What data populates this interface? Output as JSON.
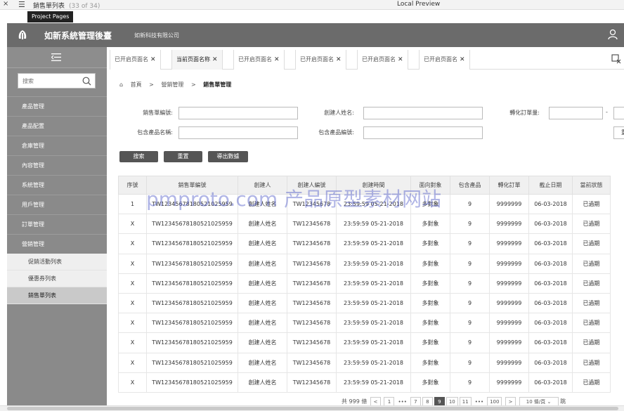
{
  "window": {
    "close_glyph": "×",
    "menu_glyph": "☰",
    "page_title": "銷售單列表",
    "page_count": "(33 of 34)",
    "center_title": "Local Preview",
    "tooltip": "Project Pages"
  },
  "header": {
    "system_title": "如新系統管理後臺",
    "company": "如新科技有限公司"
  },
  "sidebar": {
    "search_placeholder": "搜索",
    "items": [
      {
        "label": "產品管理"
      },
      {
        "label": "產品配置"
      },
      {
        "label": "倉庫管理"
      },
      {
        "label": "內容管理"
      },
      {
        "label": "系統管理"
      },
      {
        "label": "用戶管理"
      },
      {
        "label": "訂單管理"
      },
      {
        "label": "營銷管理"
      }
    ],
    "sub_items": [
      {
        "label": "促銷活動列表"
      },
      {
        "label": "優惠券列表"
      },
      {
        "label": "銷售單列表"
      }
    ]
  },
  "tabs": [
    {
      "label": "已开启页面名"
    },
    {
      "label": "当前页面名称"
    },
    {
      "label": "已开启页面名"
    },
    {
      "label": "已开启页面名"
    },
    {
      "label": "已开启页面名"
    },
    {
      "label": "已开启页面名"
    }
  ],
  "tab_close_glyph": "✕",
  "breadcrumb": {
    "home": "首頁",
    "sep": ">",
    "level1": "營銷管理",
    "current": "銷售單管理"
  },
  "form": {
    "order_no_label": "銷售單編號:",
    "creator_name_label": "創建人姓名:",
    "convert_qty_label": "轉化訂單量:",
    "range_sep": "-",
    "product_name_label": "包含產品名稱:",
    "product_no_label": "包含產品編號:",
    "reset_partial": "重"
  },
  "buttons": {
    "search": "搜索",
    "reset": "重置",
    "export": "導出數據"
  },
  "table": {
    "headers": [
      "序號",
      "銷售單編號",
      "創建人",
      "創建人編號",
      "創建時間",
      "面向對象",
      "包含產品",
      "轉化訂單",
      "截止日期",
      "當前狀態"
    ],
    "rows": [
      [
        "1",
        "TW12345678180521025959",
        "創建人姓名",
        "TW12345678",
        "23:59:59 05-21-2018",
        "多對象",
        "9",
        "9999999",
        "06-03-2018",
        "已過期"
      ],
      [
        "X",
        "TW12345678180521025959",
        "創建人姓名",
        "TW12345678",
        "23:59:59 05-21-2018",
        "多對象",
        "9",
        "9999999",
        "06-03-2018",
        "已過期"
      ],
      [
        "X",
        "TW12345678180521025959",
        "創建人姓名",
        "TW12345678",
        "23:59:59 05-21-2018",
        "多對象",
        "9",
        "9999999",
        "06-03-2018",
        "已過期"
      ],
      [
        "X",
        "TW12345678180521025959",
        "創建人姓名",
        "TW12345678",
        "23:59:59 05-21-2018",
        "多對象",
        "9",
        "9999999",
        "06-03-2018",
        "已過期"
      ],
      [
        "X",
        "TW12345678180521025959",
        "創建人姓名",
        "TW12345678",
        "23:59:59 05-21-2018",
        "多對象",
        "9",
        "9999999",
        "06-03-2018",
        "已過期"
      ],
      [
        "X",
        "TW12345678180521025959",
        "創建人姓名",
        "TW12345678",
        "23:59:59 05-21-2018",
        "多對象",
        "9",
        "9999999",
        "06-03-2018",
        "已過期"
      ],
      [
        "X",
        "TW12345678180521025959",
        "創建人姓名",
        "TW12345678",
        "23:59:59 05-21-2018",
        "多對象",
        "9",
        "9999999",
        "06-03-2018",
        "已過期"
      ],
      [
        "X",
        "TW12345678180521025959",
        "創建人姓名",
        "TW12345678",
        "23:59:59 05-21-2018",
        "多對象",
        "9",
        "9999999",
        "06-03-2018",
        "已過期"
      ],
      [
        "X",
        "TW12345678180521025959",
        "創建人姓名",
        "TW12345678",
        "23:59:59 05-21-2018",
        "多對象",
        "9",
        "9999999",
        "06-03-2018",
        "已過期"
      ],
      [
        "X",
        "TW12345678180521025959",
        "創建人姓名",
        "TW12345678",
        "23:59:59 05-21-2018",
        "多對象",
        "9",
        "9999999",
        "06-03-2018",
        "已過期"
      ]
    ]
  },
  "pagination": {
    "total": "共 999 條",
    "prev": "<",
    "pages": [
      "1",
      "•••",
      "7",
      "8",
      "9",
      "10",
      "11",
      "•••",
      "100"
    ],
    "active_page": "9",
    "next": ">",
    "page_size": "10 條/頁",
    "jump": "跳"
  },
  "watermark": "pmproto.com 产品原型素材网站"
}
